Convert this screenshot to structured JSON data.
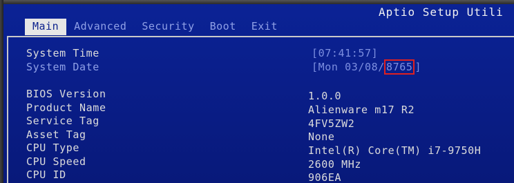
{
  "header": {
    "title": "Aptio Setup Utili"
  },
  "tabs": [
    {
      "label": "Main",
      "active": true
    },
    {
      "label": "Advanced",
      "active": false
    },
    {
      "label": "Security",
      "active": false
    },
    {
      "label": "Boot",
      "active": false
    },
    {
      "label": "Exit",
      "active": false
    }
  ],
  "main": {
    "system_time": {
      "label": "System Time",
      "value": "[07:41:57]"
    },
    "system_date": {
      "label": "System Date",
      "value_prefix": "[Mon 03/08/",
      "value_year": "8765",
      "value_suffix": "]"
    },
    "info": [
      {
        "label": "BIOS Version",
        "value": "1.0.0"
      },
      {
        "label": "Product Name",
        "value": "Alienware m17 R2"
      },
      {
        "label": "Service Tag",
        "value": "4FV5ZW2"
      },
      {
        "label": "Asset Tag",
        "value": "None"
      },
      {
        "label": "CPU Type",
        "value": "Intel(R) Core(TM) i7-9750H"
      },
      {
        "label": "CPU Speed",
        "value": "2600 MHz"
      },
      {
        "label": "CPU ID",
        "value": "906EA"
      }
    ]
  },
  "colors": {
    "background": "#0a1f8c",
    "active_tab_bg": "#e6e6e6",
    "inactive_tab_text": "#8fa0e6",
    "text": "#dcdcdc",
    "editable_value": "#7d8fe0",
    "highlight_border": "#e02020"
  }
}
